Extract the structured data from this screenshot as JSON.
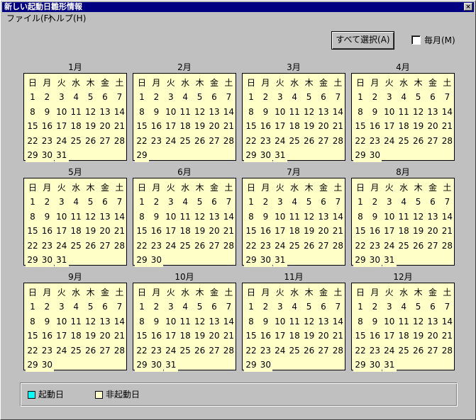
{
  "window": {
    "title": "新しい起動日雛形情報",
    "close_label": "×"
  },
  "menu": [
    "ファイル(F)",
    "ヘルプ(H)"
  ],
  "toolbar": {
    "select_all_label": "すべて選択(A)",
    "monthly_label": "毎月(M)",
    "monthly_checked": false
  },
  "weekdays": [
    "日",
    "月",
    "火",
    "水",
    "木",
    "金",
    "土"
  ],
  "months": [
    {
      "title": "1月",
      "days": 31,
      "first_weekday": 1
    },
    {
      "title": "2月",
      "days": 29,
      "first_weekday": 1
    },
    {
      "title": "3月",
      "days": 31,
      "first_weekday": 1
    },
    {
      "title": "4月",
      "days": 30,
      "first_weekday": 1
    },
    {
      "title": "5月",
      "days": 31,
      "first_weekday": 1
    },
    {
      "title": "6月",
      "days": 30,
      "first_weekday": 1
    },
    {
      "title": "7月",
      "days": 31,
      "first_weekday": 1
    },
    {
      "title": "8月",
      "days": 31,
      "first_weekday": 1
    },
    {
      "title": "9月",
      "days": 30,
      "first_weekday": 1
    },
    {
      "title": "10月",
      "days": 31,
      "first_weekday": 1
    },
    {
      "title": "11月",
      "days": 30,
      "first_weekday": 1
    },
    {
      "title": "12月",
      "days": 31,
      "first_weekday": 1
    }
  ],
  "legend": {
    "startup": {
      "label": "起動日",
      "color": "#00ffff"
    },
    "non_startup": {
      "label": "非起動日",
      "color": "#ffffc8"
    }
  }
}
